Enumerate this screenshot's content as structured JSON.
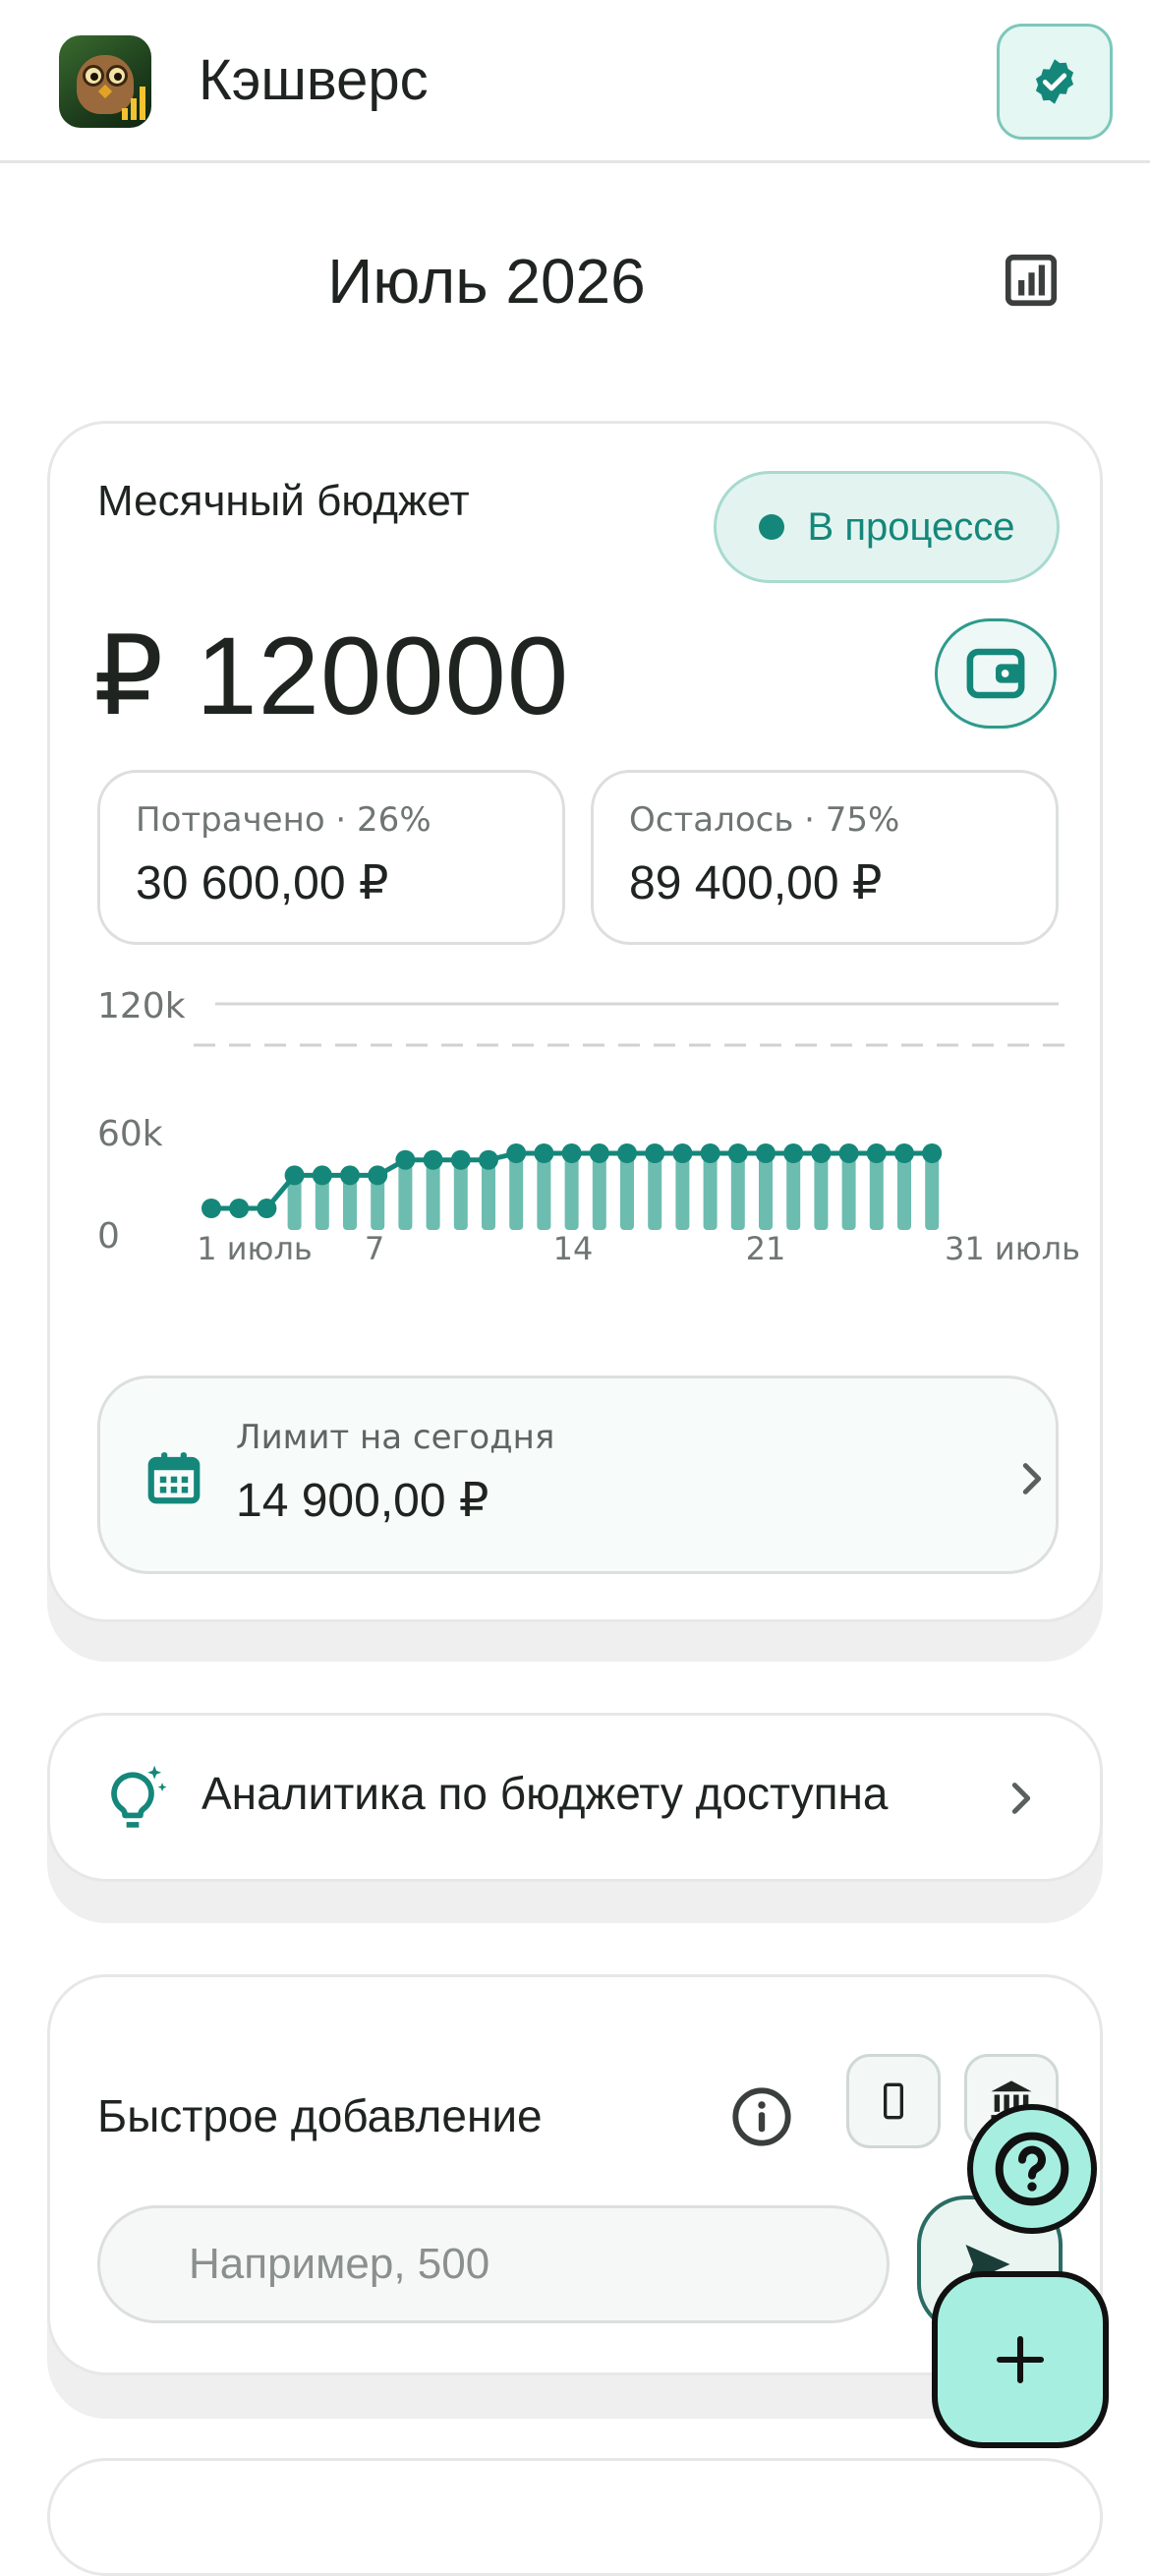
{
  "app": {
    "title": "Кэшверс"
  },
  "icons": {
    "logo": "owl-logo-icon",
    "verify": "verified-badge-icon",
    "stats": "bar-chart-icon",
    "wallet": "wallet-icon",
    "calendar": "calendar-icon",
    "bulb": "lightbulb-sparkle-icon",
    "info": "info-icon",
    "phone": "phone-icon",
    "bank": "bank-icon",
    "send": "send-icon",
    "help": "help-icon",
    "add": "plus-icon"
  },
  "colors": {
    "accent": "#14877a",
    "accent_light": "#e3f4f0",
    "fab": "#a6efe0"
  },
  "header": {
    "month": "Июль 2026"
  },
  "budget": {
    "label": "Месячный бюджет",
    "status": "В процессе",
    "amount": "₽ 120000",
    "spent_label": "Потрачено · 26%",
    "spent_value": "30 600,00 ₽",
    "left_label": "Осталось · 75%",
    "left_value": "89 400,00 ₽"
  },
  "chart_data": {
    "type": "line",
    "title": "",
    "xlabel": "",
    "ylabel": "",
    "ylim": [
      0,
      120000
    ],
    "y_ticks": [
      "120k",
      "60k",
      "0"
    ],
    "x_ticks": [
      {
        "day": 1,
        "label": "1 июль"
      },
      {
        "day": 7,
        "label": "7"
      },
      {
        "day": 14,
        "label": "14"
      },
      {
        "day": 21,
        "label": "21"
      },
      {
        "day": 31,
        "label": "31 июль"
      }
    ],
    "limit_line": 120000,
    "x": [
      1,
      2,
      3,
      4,
      5,
      6,
      7,
      8,
      9,
      10,
      11,
      12,
      13,
      14,
      15,
      16,
      17,
      18,
      19,
      20,
      21,
      22,
      23,
      24,
      25,
      26,
      27
    ],
    "series": [
      {
        "values": [
          0,
          0,
          0,
          15000,
          15000,
          15000,
          15000,
          22000,
          22000,
          22000,
          22000,
          25000,
          25000,
          25000,
          25000,
          25000,
          25000,
          25000,
          25000,
          25000,
          25000,
          25000,
          25000,
          25000,
          25000,
          25000,
          25000
        ]
      }
    ]
  },
  "limit_today": {
    "label": "Лимит на сегодня",
    "value": "14 900,00 ₽"
  },
  "insight": {
    "text": "Аналитика по бюджету доступна"
  },
  "quick_add": {
    "label": "Быстрое добавление",
    "placeholder": "Например, 500"
  }
}
